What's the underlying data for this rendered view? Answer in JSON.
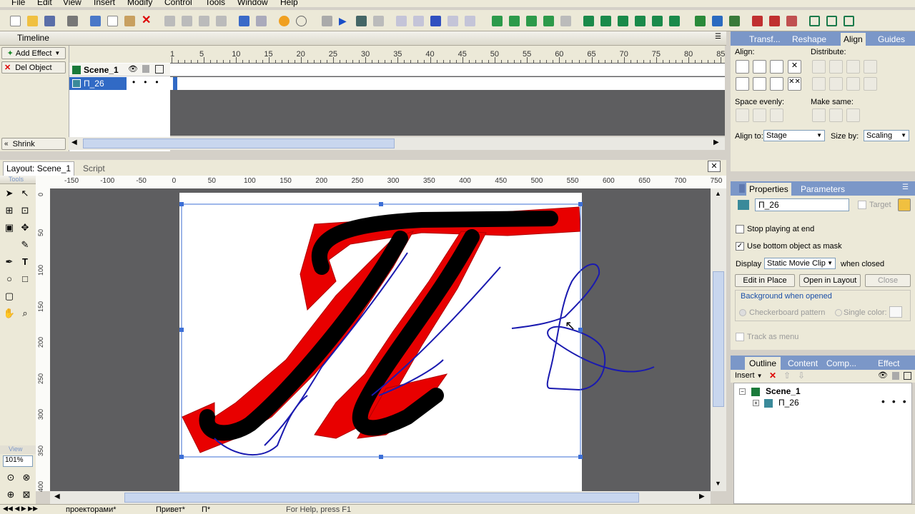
{
  "menu": [
    "File",
    "Edit",
    "View",
    "Insert",
    "Modify",
    "Control",
    "Tools",
    "Window",
    "Help"
  ],
  "timeline": {
    "title": "Timeline",
    "add_effect": "Add Effect",
    "del_object": "Del Object",
    "shrink": "Shrink",
    "scene": "Scene_1",
    "layer": "П_26",
    "frames": [
      "1",
      "5",
      "10",
      "15",
      "20",
      "25",
      "30",
      "35",
      "40",
      "45",
      "50",
      "55",
      "60",
      "65",
      "70",
      "75",
      "80",
      "85"
    ]
  },
  "layout": {
    "tab_layout": "Layout: Scene_1",
    "tab_script": "Script",
    "tools_label": "Tools",
    "view_label": "View",
    "zoom": "101%",
    "hruler": [
      "-150",
      "-100",
      "-50",
      "0",
      "50",
      "100",
      "150",
      "200",
      "250",
      "300",
      "350",
      "400",
      "450",
      "500",
      "550",
      "600",
      "650",
      "700",
      "750"
    ],
    "vruler": [
      "0",
      "50",
      "100",
      "150",
      "200",
      "250",
      "300",
      "350",
      "400"
    ]
  },
  "right_tabs": [
    "Transf...",
    "Reshape",
    "Align",
    "Guides"
  ],
  "align": {
    "align_label": "Align:",
    "distribute_label": "Distribute:",
    "space_label": "Space evenly:",
    "same_label": "Make same:",
    "align_to_label": "Align to:",
    "align_to": "Stage",
    "size_by_label": "Size by:",
    "size_by": "Scaling"
  },
  "properties": {
    "tab_props": "Properties",
    "tab_params": "Parameters",
    "name": "П_26",
    "target": "Target",
    "stop": "Stop playing at end",
    "mask": "Use bottom object as mask",
    "display_label": "Display",
    "display": "Static Movie Clip",
    "when_closed": "when closed",
    "edit_place": "Edit in Place",
    "open_layout": "Open in Layout",
    "close": "Close",
    "bg_opened": "Background when opened",
    "checker": "Checkerboard pattern",
    "single": "Single color:",
    "track": "Track as menu"
  },
  "outline": {
    "tabs": [
      "Outline",
      "Content",
      "Comp...",
      "Effect"
    ],
    "insert": "Insert",
    "scene": "Scene_1",
    "item": "П_26"
  },
  "status": {
    "tabs": [
      "проекторами*",
      "Привет*",
      "П*"
    ],
    "help": "For Help, press F1"
  },
  "colors": {
    "accent": "#316ac5",
    "tabbar": "#7b97c8",
    "stroke_red": "#e80000",
    "stroke_blue": "#1a1ab0"
  }
}
